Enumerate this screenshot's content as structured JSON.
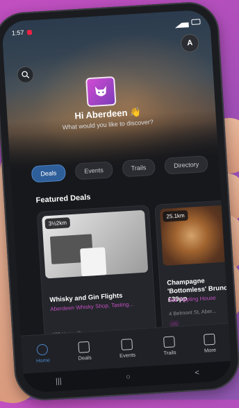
{
  "status": {
    "time": "1:57"
  },
  "header": {
    "avatar_initial": "A",
    "greeting": "Hi Aberdeen 👋",
    "subtitle": "What would you like to discover?"
  },
  "tabs": [
    {
      "label": "Deals"
    },
    {
      "label": "Events"
    },
    {
      "label": "Trails"
    },
    {
      "label": "Directory"
    }
  ],
  "section_title": "Featured Deals",
  "deals": [
    {
      "distance": "3½2km",
      "title": "Whisky and Gin Flights",
      "venue": "Aberdeen Whisky Shop, Tasting...",
      "address": "472 Union St,"
    },
    {
      "distance": "25.1km",
      "title": "Champagne 'Bottomless' Brunch £39pp",
      "venue": "The Tippling House",
      "address": "4 Belmont St, Aber..."
    }
  ],
  "nav": [
    {
      "label": "Home",
      "icon": "home-icon"
    },
    {
      "label": "Deals",
      "icon": "deals-icon"
    },
    {
      "label": "Events",
      "icon": "events-icon"
    },
    {
      "label": "Trails",
      "icon": "trails-icon"
    },
    {
      "label": "More",
      "icon": "more-icon"
    }
  ],
  "system_nav": {
    "recents": "|||",
    "home": "○",
    "back": "<"
  }
}
